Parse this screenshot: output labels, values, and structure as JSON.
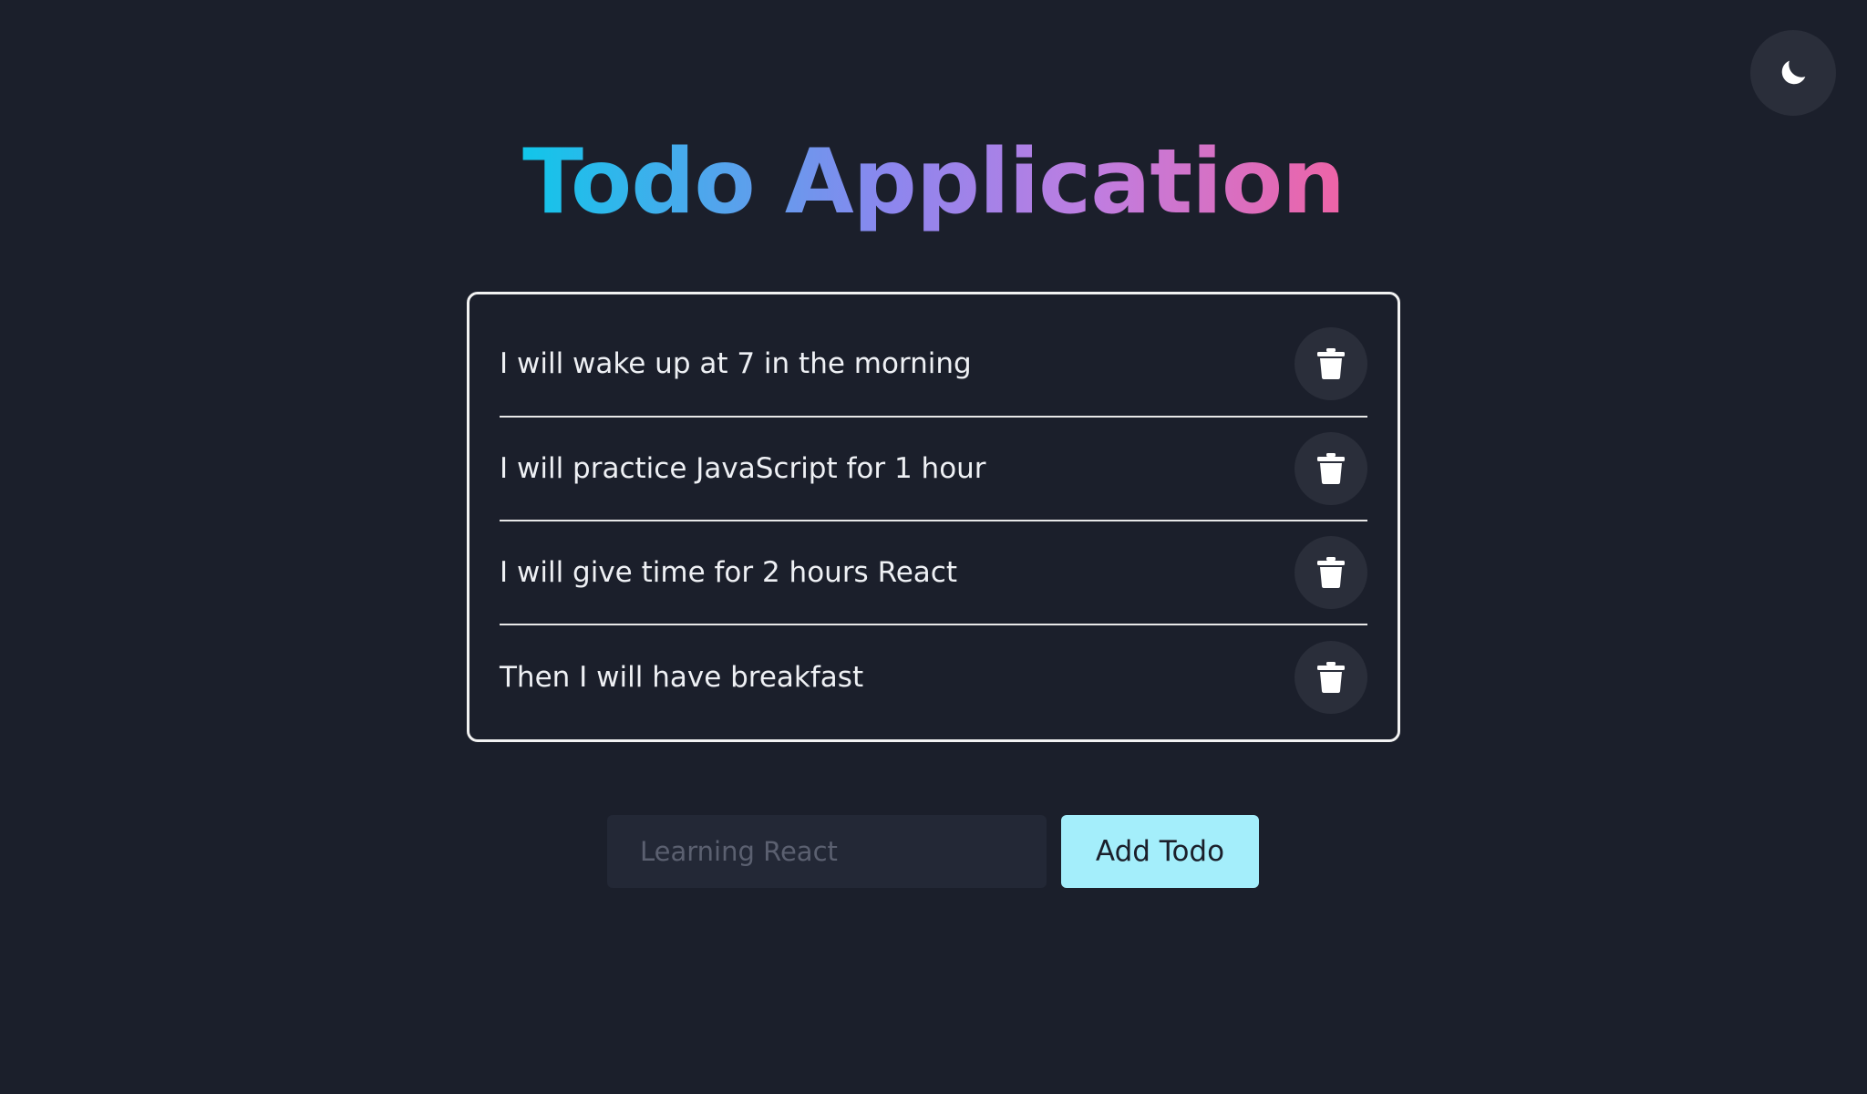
{
  "header": {
    "title": "Todo Application",
    "theme_toggle_icon": "moon-icon"
  },
  "todos": [
    {
      "text": "I will wake up at 7 in the morning",
      "delete_icon": "trash-icon"
    },
    {
      "text": "I will practice JavaScript for 1 hour",
      "delete_icon": "trash-icon"
    },
    {
      "text": "I will give time for 2 hours React",
      "delete_icon": "trash-icon"
    },
    {
      "text": "Then I will have breakfast",
      "delete_icon": "trash-icon"
    }
  ],
  "form": {
    "input_value": "",
    "input_placeholder": "Learning React",
    "add_label": "Add Todo"
  },
  "colors": {
    "background": "#1b1f2b",
    "accent_button": "#a4eefb",
    "title_gradient": [
      "#11c6ea",
      "#8d86ee",
      "#c07de0",
      "#ee63a6"
    ]
  }
}
